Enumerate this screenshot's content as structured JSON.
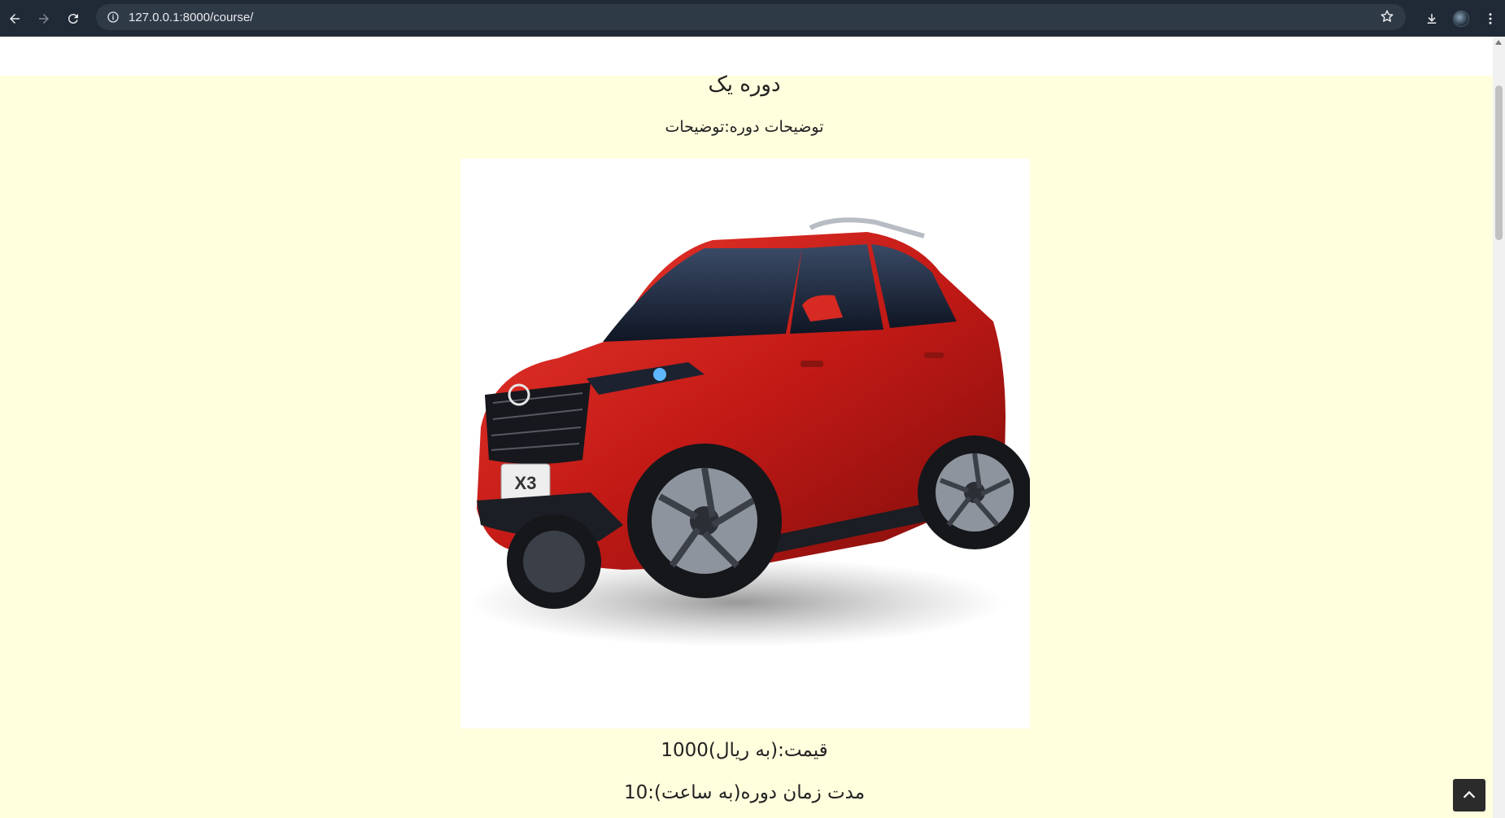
{
  "browser": {
    "url": "127.0.0.1:8000/course/",
    "icons": [
      "back-arrow-icon",
      "forward-arrow-icon",
      "reload-icon",
      "info-icon",
      "star-icon",
      "download-icon",
      "profile-avatar",
      "menu-dots-icon"
    ]
  },
  "course": {
    "title": "دوره یک",
    "description": "توضیحات دوره:توضیحات",
    "image_alt": "red SUV car",
    "image_badge": "X3",
    "price": "قیمت:(به ریال)1000",
    "duration": "مدت زمان دوره(به ساعت):10"
  },
  "colors": {
    "page_background": "#fffedd",
    "browser_bar": "#202a36",
    "car_red": "#c41a16"
  }
}
